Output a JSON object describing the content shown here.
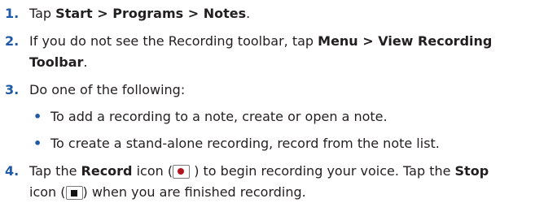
{
  "colors": {
    "accent": "#1f5aa6",
    "text": "#231f20",
    "record": "#b0161c"
  },
  "steps": [
    {
      "number": "1.",
      "pre": "Tap ",
      "bold": "Start > Programs > Notes",
      "post": "."
    },
    {
      "number": "2.",
      "pre": "If you do not see the Recording toolbar, tap ",
      "bold_line1": "Menu > View Recording",
      "bold_line2": "Toolbar",
      "post": "."
    },
    {
      "number": "3.",
      "text": "Do one of the following:",
      "bullet_glyph": "•",
      "bullets": [
        "To add a recording to a note, create or open a note.",
        "To create a stand-alone recording, record from the note list."
      ]
    },
    {
      "number": "4.",
      "pre": "Tap the ",
      "bold1": "Record",
      "mid1": " icon (",
      "mid2": " ) to begin recording your voice. Tap the ",
      "bold2": "Stop",
      "line2_pre": "icon (",
      "line2_post": ") when you are finished recording.",
      "icons": [
        "record-icon",
        "stop-icon"
      ]
    }
  ]
}
